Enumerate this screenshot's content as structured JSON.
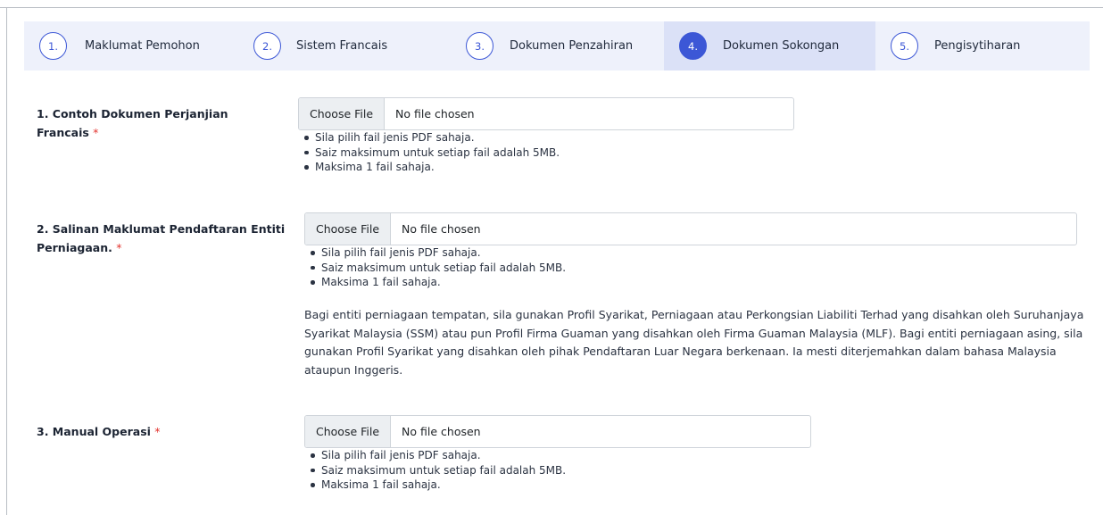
{
  "stepper": {
    "steps": [
      {
        "number": "1.",
        "label": "Maklumat Pemohon"
      },
      {
        "number": "2.",
        "label": "Sistem Francais"
      },
      {
        "number": "3.",
        "label": "Dokumen Penzahiran"
      },
      {
        "number": "4.",
        "label": "Dokumen Sokongan",
        "active": true
      },
      {
        "number": "5.",
        "label": "Pengisytiharan"
      }
    ]
  },
  "fields": [
    {
      "label": "1. Contoh Dokumen Perjanjian Francais",
      "required_mark": "*",
      "button_label": "Choose File",
      "file_status": "No file chosen",
      "hints": [
        "Sila pilih fail jenis PDF sahaja.",
        "Saiz maksimum untuk setiap fail adalah 5MB.",
        "Maksima 1 fail sahaja."
      ]
    },
    {
      "label": "2. Salinan Maklumat Pendaftaran Entiti Perniagaan.",
      "required_mark": "*",
      "button_label": "Choose File",
      "file_status": "No file chosen",
      "hints": [
        "Sila pilih fail jenis PDF sahaja.",
        "Saiz maksimum untuk setiap fail adalah 5MB.",
        "Maksima 1 fail sahaja."
      ],
      "note": "Bagi entiti perniagaan tempatan, sila gunakan Profil Syarikat, Perniagaan atau Perkongsian Liabiliti Terhad yang disahkan oleh Suruhanjaya Syarikat Malaysia (SSM) atau pun Profil Firma Guaman yang disahkan oleh Firma Guaman Malaysia (MLF). Bagi entiti perniagaan asing, sila gunakan Profil Syarikat yang disahkan oleh pihak Pendaftaran Luar Negara berkenaan. Ia mesti diterjemahkan dalam bahasa Malaysia ataupun Inggeris."
    },
    {
      "label": "3. Manual Operasi",
      "required_mark": "*",
      "button_label": "Choose File",
      "file_status": "No file chosen",
      "hints": [
        "Sila pilih fail jenis PDF sahaja.",
        "Saiz maksimum untuk setiap fail adalah 5MB.",
        "Maksima 1 fail sahaja."
      ]
    }
  ],
  "colors": {
    "accent": "#3c57d6",
    "required": "#e3342f",
    "stepper_bg": "#eef1fb",
    "stepper_active_bg": "#dbe1f7"
  }
}
